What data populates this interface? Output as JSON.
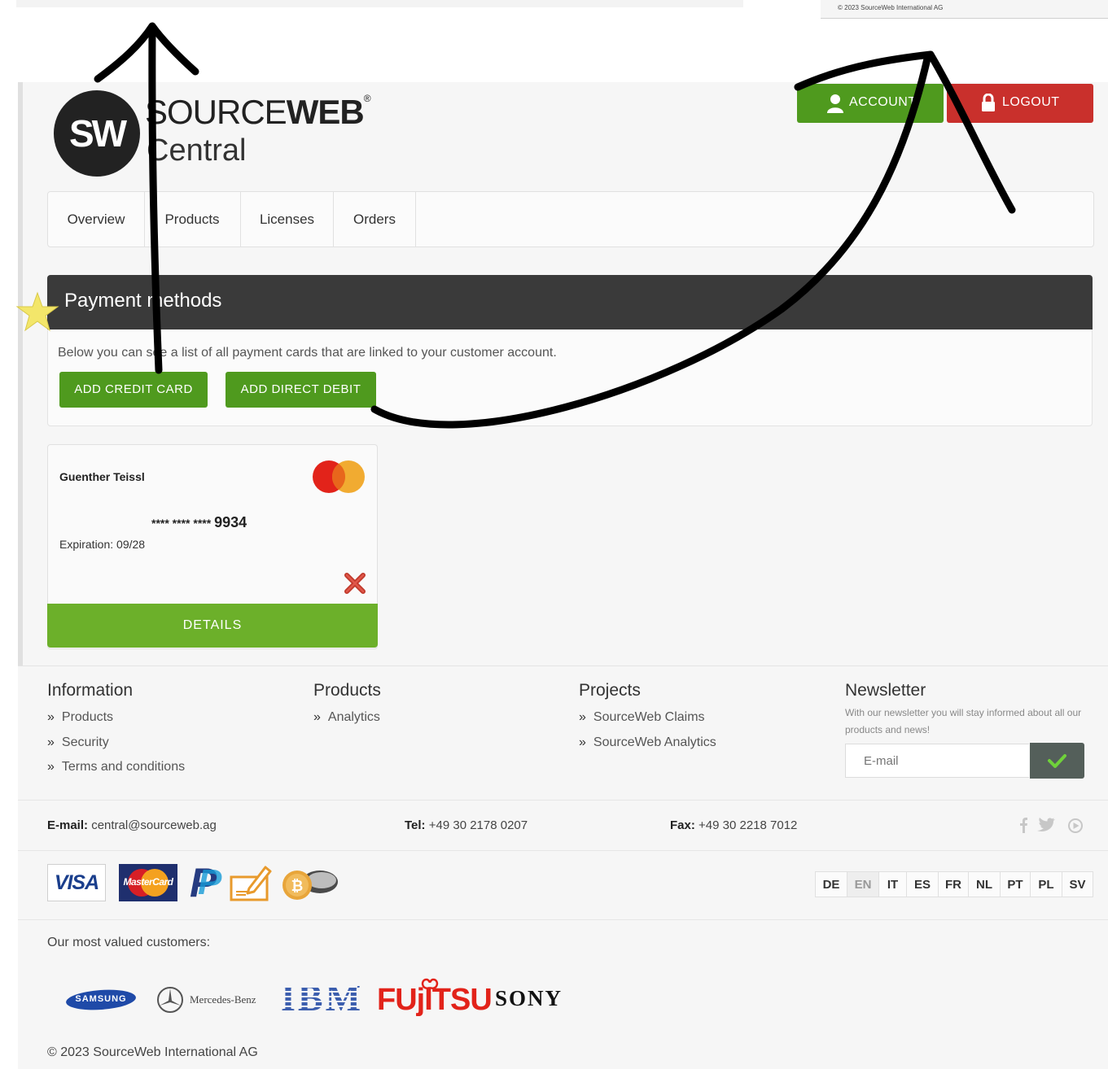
{
  "top_copyright": "© 2023 SourceWeb International AG",
  "logo": {
    "mark": "SW",
    "brand_light": "SOURCE",
    "brand_bold": "WEB",
    "registered": "®",
    "sub": "Central"
  },
  "header": {
    "account_label": "ACCOUNT",
    "logout_label": "LOGOUT"
  },
  "nav": {
    "tabs": [
      "Overview",
      "Products",
      "Licenses",
      "Orders"
    ]
  },
  "payment": {
    "title": "Payment methods",
    "description": "Below you can see a list of all payment cards that are linked to your customer account.",
    "add_credit_card": "ADD CREDIT CARD",
    "add_direct_debit": "ADD DIRECT DEBIT"
  },
  "card": {
    "holder": "Guenther Teissl",
    "masked": "**** **** ****",
    "last4": "9934",
    "expiration": "Expiration: 09/28",
    "details_label": "DETAILS",
    "brand_icon": "mastercard-icon",
    "delete_icon": "close-icon"
  },
  "footer": {
    "information": {
      "title": "Information",
      "links": [
        "Products",
        "Security",
        "Terms and conditions"
      ]
    },
    "products": {
      "title": "Products",
      "links": [
        "Analytics"
      ]
    },
    "projects": {
      "title": "Projects",
      "links": [
        "SourceWeb Claims",
        "SourceWeb Analytics"
      ]
    },
    "newsletter": {
      "title": "Newsletter",
      "text": "With our newsletter you will stay informed about all our products and news!",
      "placeholder": "E-mail"
    },
    "contact": {
      "email_label": "E-mail:",
      "email": "central@sourceweb.ag",
      "tel_label": "Tel:",
      "tel": "+49 30 2178 0207",
      "fax_label": "Fax:",
      "fax": "+49 30 2218 7012"
    },
    "social_icons": [
      "facebook-icon",
      "twitter-icon",
      "youtube-icon"
    ],
    "payment_logos": {
      "visa": "VISA",
      "mastercard": "MasterCard",
      "paypal": "P"
    },
    "languages": [
      "DE",
      "EN",
      "IT",
      "ES",
      "FR",
      "NL",
      "PT",
      "PL",
      "SV"
    ],
    "active_language": "EN",
    "customers_label": "Our most valued customers:",
    "customers": {
      "samsung": "SAMSUNG",
      "mercedes": "Mercedes-Benz",
      "ibm": "IBM",
      "fujitsu": "FUjITSU",
      "sony": "SONY"
    },
    "copyright": "© 2023 SourceWeb International AG"
  },
  "colors": {
    "green": "#4f9a1e",
    "details_green": "#6cb02a",
    "red": "#c9302c",
    "dark_header": "#3a3a3a",
    "annotation_ink": "#000000",
    "star": "#f3e66a"
  }
}
